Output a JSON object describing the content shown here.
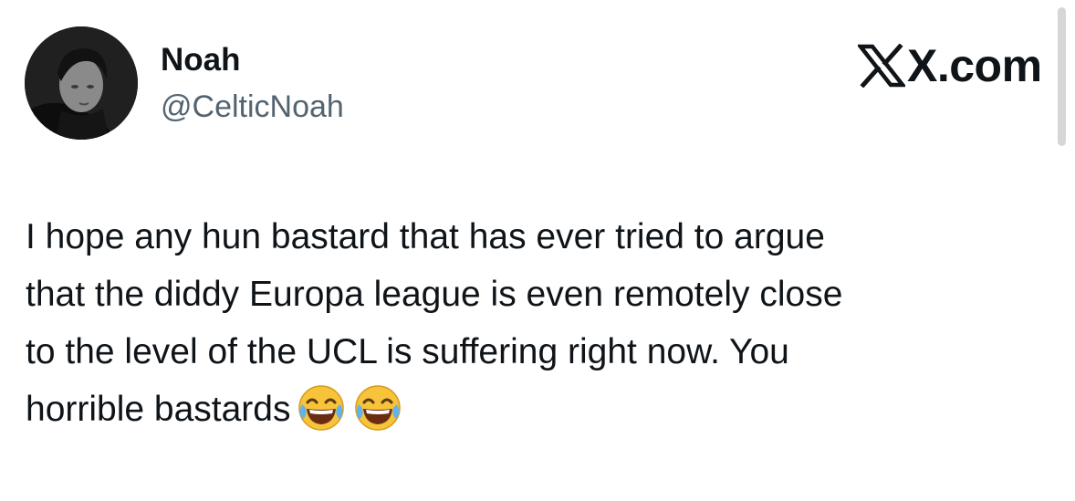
{
  "author": {
    "display_name": "Noah",
    "handle": "@CelticNoah",
    "avatar_icon": "profile-photo"
  },
  "brand": {
    "icon": "x-logo-icon",
    "label": "X.com"
  },
  "tweet": {
    "lines": [
      "I hope any hun bastard that has ever tried to argue",
      "that the diddy Europa league is even remotely close",
      "to the level of the UCL is suffering right now. You",
      "horrible bastards"
    ],
    "emojis": [
      "😂",
      "😂"
    ],
    "emoji_icon": "face-with-tears-of-joy-icon"
  },
  "colors": {
    "text_primary": "#0f1419",
    "text_secondary": "#536471",
    "background": "#ffffff"
  }
}
